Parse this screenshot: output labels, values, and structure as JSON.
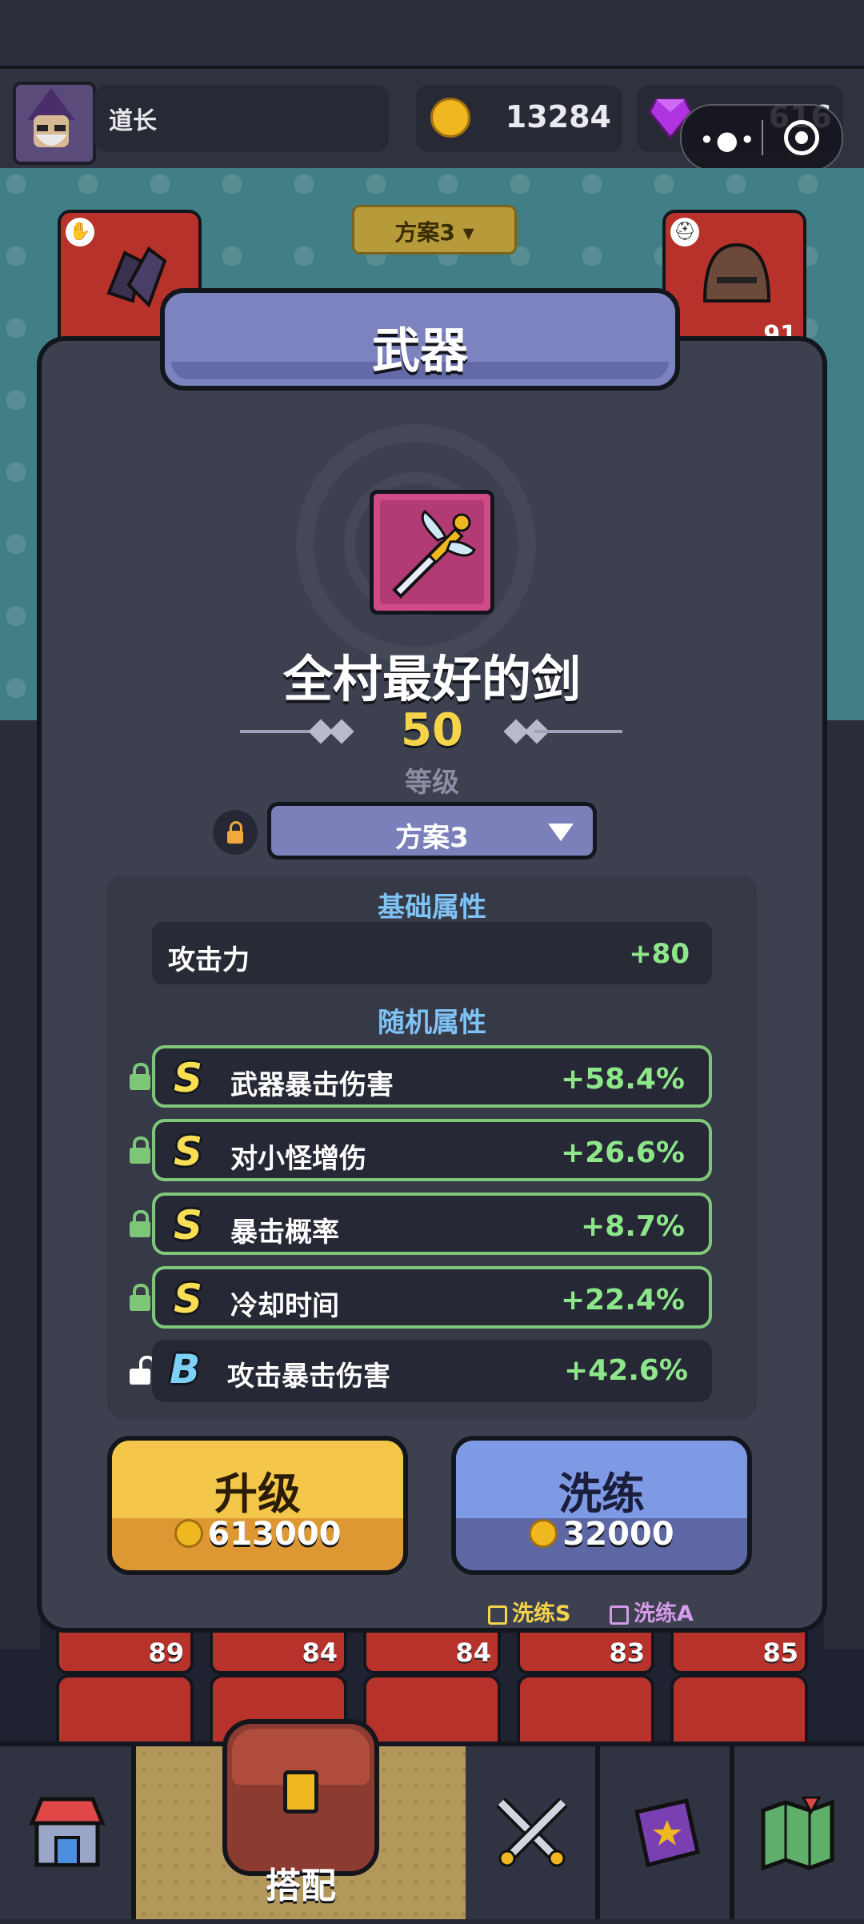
{
  "header": {
    "player_name": "道长",
    "coins": "13284",
    "gems": "616",
    "colors": {
      "coin": "#f0b820",
      "gem": "#b033e0"
    }
  },
  "miniprogram": {
    "more_icon": "more-dots-icon",
    "close_icon": "target-icon"
  },
  "plan_top": {
    "label": "方案3 ▾"
  },
  "slots_top": [
    {
      "name": "gloves",
      "icon": "gloves-icon",
      "level": ""
    },
    {
      "name": "helmet",
      "icon": "helmet-icon",
      "level": "91"
    }
  ],
  "panel": {
    "title": "武器",
    "item": {
      "name": "全村最好的剑",
      "level": "50",
      "level_label": "等级",
      "icon": "winged-sword-icon"
    },
    "plan_select": {
      "label": "方案3"
    },
    "base_section": {
      "title": "基础属性",
      "attr": {
        "label": "攻击力",
        "value": "+80"
      }
    },
    "random_section": {
      "title": "随机属性",
      "attrs": [
        {
          "grade": "S",
          "label": "武器暴击伤害",
          "value": "+58.4%",
          "locked": true
        },
        {
          "grade": "S",
          "label": "对小怪增伤",
          "value": "+26.6%",
          "locked": true
        },
        {
          "grade": "S",
          "label": "暴击概率",
          "value": "+8.7%",
          "locked": true
        },
        {
          "grade": "S",
          "label": "冷却时间",
          "value": "+22.4%",
          "locked": true
        },
        {
          "grade": "B",
          "label": "攻击暴击伤害",
          "value": "+42.6%",
          "locked": false
        }
      ]
    },
    "upgrade_button": {
      "label": "升级",
      "cost": "613000"
    },
    "reforge_button": {
      "label": "洗练",
      "cost": "32000"
    },
    "checkbox_s": {
      "label": "洗练S"
    },
    "checkbox_a": {
      "label": "洗练A"
    }
  },
  "slot_levels": [
    "89",
    "84",
    "84",
    "83",
    "85"
  ],
  "bottom_nav": {
    "items": [
      {
        "icon": "shop-icon"
      },
      {
        "icon": "bag-icon",
        "label": "搭配",
        "active": true
      },
      {
        "icon": "crossed-swords-icon"
      },
      {
        "icon": "spellbook-icon"
      },
      {
        "icon": "map-icon"
      }
    ]
  }
}
